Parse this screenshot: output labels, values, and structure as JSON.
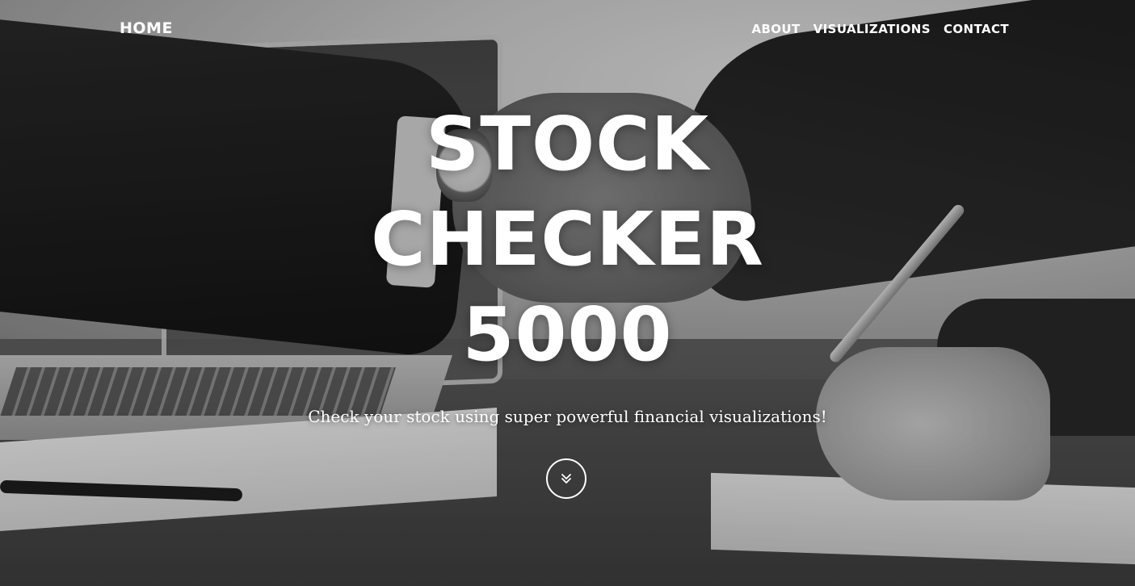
{
  "nav": {
    "home_label": "HOME",
    "links": [
      {
        "label": "ABOUT"
      },
      {
        "label": "VISUALIZATIONS"
      },
      {
        "label": "CONTACT"
      }
    ]
  },
  "hero": {
    "title_lines": [
      "STOCK",
      "CHECKER",
      "5000"
    ],
    "subtitle": "Check your stock using super powerful financial visualizations!",
    "scroll_icon": "double-chevron-down-icon",
    "background_image": "handshake-over-desk-photo"
  }
}
